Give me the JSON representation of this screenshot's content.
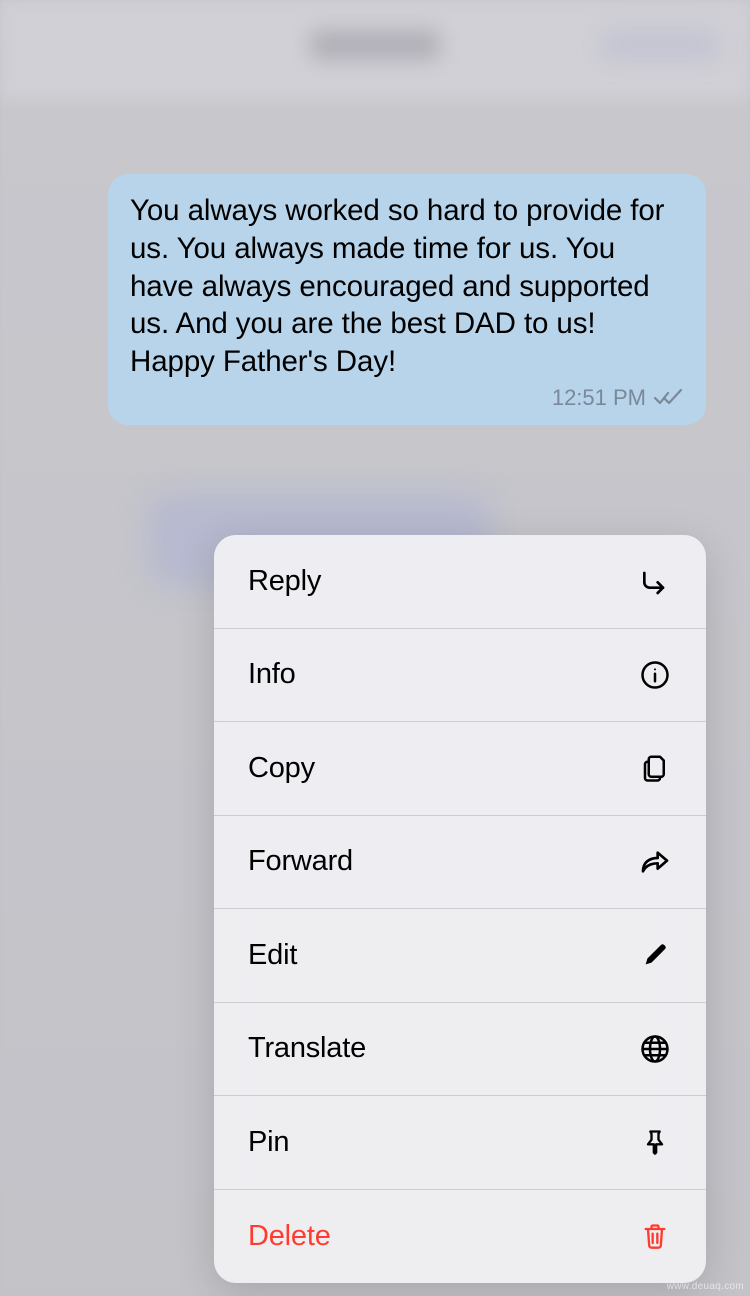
{
  "message": {
    "text": "You always worked so hard to provide for us. You always made time for us. You have always encouraged and supported us. And you are the best DAD to us! Happy Father's Day!",
    "timestamp": "12:51 PM",
    "read_status": "read"
  },
  "menu": {
    "items": [
      {
        "label": "Reply",
        "icon": "reply-icon",
        "destructive": false
      },
      {
        "label": "Info",
        "icon": "info-icon",
        "destructive": false
      },
      {
        "label": "Copy",
        "icon": "copy-icon",
        "destructive": false
      },
      {
        "label": "Forward",
        "icon": "forward-icon",
        "destructive": false
      },
      {
        "label": "Edit",
        "icon": "edit-icon",
        "destructive": false
      },
      {
        "label": "Translate",
        "icon": "globe-icon",
        "destructive": false
      },
      {
        "label": "Pin",
        "icon": "pin-icon",
        "destructive": false
      },
      {
        "label": "Delete",
        "icon": "trash-icon",
        "destructive": true
      }
    ]
  },
  "watermark": "www.deuaq.com"
}
